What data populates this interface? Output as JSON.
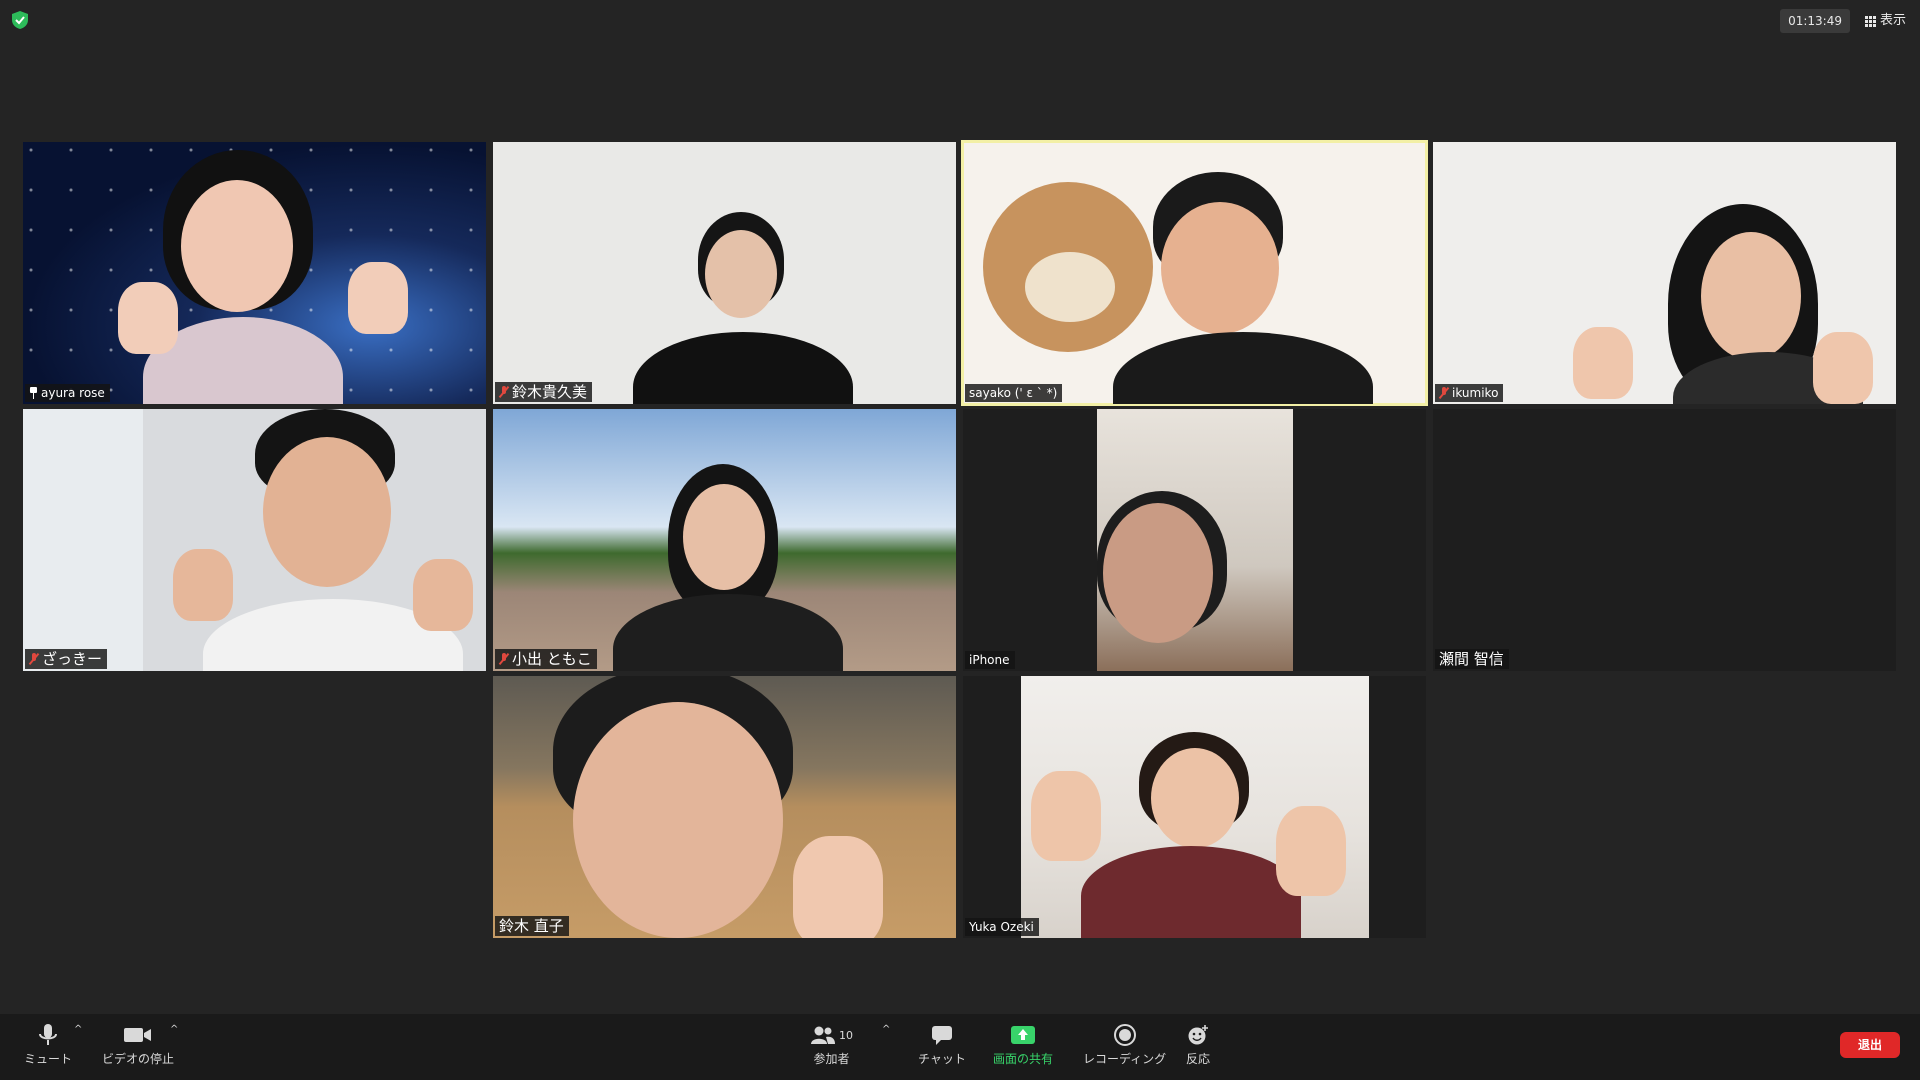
{
  "topbar": {
    "timer": "01:13:49",
    "view_label": "表示"
  },
  "participants": [
    {
      "name": "ayura rose",
      "icon": "pin-icon"
    },
    {
      "name": "鈴木貴久美",
      "icon": "mute-icon"
    },
    {
      "name": "sayako (' ε ` *)",
      "icon": "mute-icon"
    },
    {
      "name": "ikumiko",
      "icon": "mute-icon"
    },
    {
      "name": "ざっきー",
      "icon": "mute-icon"
    },
    {
      "name": "小出 ともこ",
      "icon": "mute-icon"
    },
    {
      "name": "iPhone",
      "icon": ""
    },
    {
      "name": "瀬間 智信",
      "icon": ""
    },
    {
      "name": "鈴木 直子",
      "icon": ""
    },
    {
      "name": "Yuka Ozeki",
      "icon": ""
    }
  ],
  "toolbar": {
    "mute": "ミュート",
    "video": "ビデオの停止",
    "participants": "参加者",
    "participants_count": "10",
    "chat": "チャット",
    "share": "画面の共有",
    "record": "レコーディング",
    "reactions": "反応",
    "leave": "退出"
  },
  "colors": {
    "background": "#242424",
    "active_speaker_border": "#f3f0a6",
    "share_green": "#38d36a",
    "leave_red": "#e02828"
  }
}
